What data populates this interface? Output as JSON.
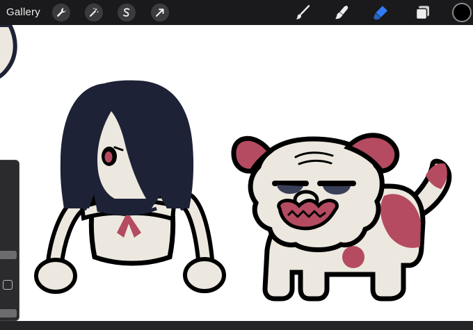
{
  "toolbar": {
    "gallery_label": "Gallery",
    "left_tools": [
      "wrench-icon",
      "magic-wand-icon",
      "selection-s-icon",
      "transform-arrow-icon"
    ],
    "right_tools": [
      "brush-icon",
      "smudge-icon",
      "eraser-icon",
      "layers-icon"
    ],
    "active_tool": "eraser-icon",
    "active_color": "#000000",
    "accent_color": "#2f7cf6"
  },
  "canvas": {
    "background": "#ffffff",
    "palette": {
      "outline": "#000000",
      "hair": "#1d2236",
      "skin": "#ece8df",
      "accent_red": "#b54b60"
    }
  }
}
